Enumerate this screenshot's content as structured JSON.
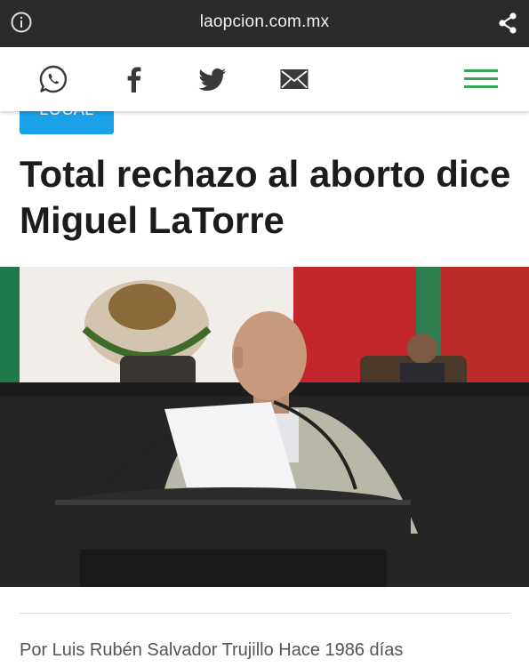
{
  "browser": {
    "url": "laopcion.com.mx",
    "info_icon": "info-icon",
    "share_icon": "share-icon"
  },
  "social": {
    "icons": [
      "whatsapp-icon",
      "facebook-icon",
      "twitter-icon",
      "mail-icon",
      "hamburger-menu-icon"
    ],
    "menu_color": "#3aa757"
  },
  "article": {
    "category": "LOCAL",
    "headline": "Total rechazo al aborto dice Miguel LaTorre",
    "byline": "Por Luis Rubén Salvador Trujillo Hace 1986 días"
  },
  "colors": {
    "browser_bar": "#2b2b2b",
    "badge": "#1aa1e8",
    "headline": "#1c1c1c",
    "byline": "#555555"
  }
}
